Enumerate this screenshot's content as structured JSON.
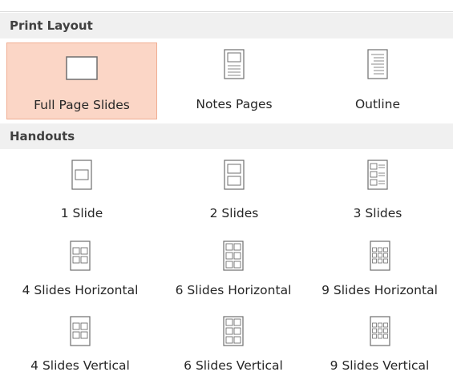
{
  "print_layout": {
    "header": "Print Layout",
    "items": [
      {
        "label": "Full Page Slides",
        "icon": "full-page-slide-icon",
        "selected": true
      },
      {
        "label": "Notes Pages",
        "icon": "notes-pages-icon",
        "selected": false
      },
      {
        "label": "Outline",
        "icon": "outline-icon",
        "selected": false
      }
    ]
  },
  "handouts": {
    "header": "Handouts",
    "items": [
      {
        "label": "1 Slide",
        "icon": "handout-1-slide-icon"
      },
      {
        "label": "2 Slides",
        "icon": "handout-2-slides-icon"
      },
      {
        "label": "3 Slides",
        "icon": "handout-3-slides-icon"
      },
      {
        "label": "4 Slides Horizontal",
        "icon": "handout-4-horizontal-icon"
      },
      {
        "label": "6 Slides Horizontal",
        "icon": "handout-6-horizontal-icon"
      },
      {
        "label": "9 Slides Horizontal",
        "icon": "handout-9-horizontal-icon"
      },
      {
        "label": "4 Slides Vertical",
        "icon": "handout-4-vertical-icon"
      },
      {
        "label": "6 Slides Vertical",
        "icon": "handout-6-vertical-icon"
      },
      {
        "label": "9 Slides Vertical",
        "icon": "handout-9-vertical-icon"
      }
    ]
  },
  "colors": {
    "selected_bg": "#fbd6c6",
    "selected_border": "#f0ae93",
    "header_bg": "#f0f0f0",
    "icon_stroke": "#7a7a7a"
  }
}
